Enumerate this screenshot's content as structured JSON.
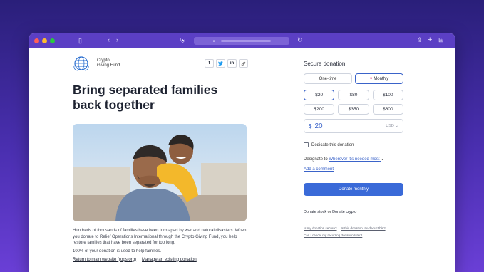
{
  "browser": {
    "url": ""
  },
  "org": {
    "name_line1": "Crypto",
    "name_line2": "Giving Fund"
  },
  "share": [
    "f",
    "t",
    "in",
    "link"
  ],
  "headline": "Bring separated families back together",
  "body": {
    "paragraph": "Hundreds of thousands of families have been torn apart by war and natural disasters. When you donate to Relief Operations International through the Crypto Giving Fund, you help restore families that have been separated for too long.",
    "paragraph2": "100% of your donation is used to help families.",
    "link_main": "Return to main website (rops.org)",
    "link_manage": "Manage an existing donation"
  },
  "donation": {
    "title": "Secure donation",
    "frequency": [
      "One-time",
      "Monthly"
    ],
    "selected_frequency": "Monthly",
    "amounts": [
      "$20",
      "$80",
      "$100",
      "$200",
      "$350",
      "$600"
    ],
    "selected_amount": "$20",
    "currency_symbol": "$",
    "amount_value": "20",
    "currency_code": "USD",
    "dedicate_label": "Dedicate this donation",
    "designate_label": "Designate to",
    "designate_value": "Wherever it's needed most",
    "add_comment": "Add a comment",
    "donate_button": "Donate monthly",
    "donate_stock": "Donate stock",
    "or": "or",
    "donate_crypto": "Donate crypto",
    "faq": [
      "Is my donation secure?",
      "Is this donation tax-deductible?",
      "Can I cancel my recurring donation later?"
    ]
  },
  "colors": {
    "accent": "#3a6ad8",
    "toolbar": "#5b3fc4"
  }
}
